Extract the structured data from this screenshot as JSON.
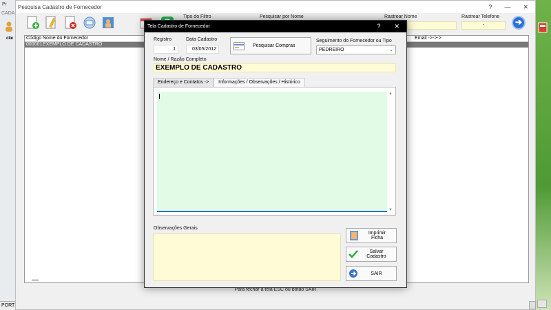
{
  "bg": {
    "app_title_abbrev": "Pr",
    "app_menu_abbrev": "CADA",
    "left_button_abbrev": "clie",
    "status_abbrev": "PORT"
  },
  "main_window": {
    "title": "Pesquisa Cadastro de Fornecedor",
    "help": "?",
    "minimize": "—",
    "close": "✕",
    "toolbar": {
      "filter_type_label": "Tipo do Filtro",
      "search_name_label": "Pesquisar por Nome",
      "track_name_label": "Rastrear Nome",
      "track_phone_label": "Rastrear Telefone",
      "track_phone_value": "-",
      "go_glyph": "➔"
    },
    "grid": {
      "columns": [
        "Código",
        "Nome do Fornecedor",
        "Email ->->->"
      ],
      "rows": [
        {
          "code": "000001",
          "name": "EXEMPLO DE CADASTRO"
        }
      ]
    },
    "hint": "Para fechar a tela ESC ou botão SAIR"
  },
  "dialog": {
    "title": "Tela Cadastro de Fornecedor",
    "help": "?",
    "close": "✕",
    "registro_label": "Registro",
    "registro_value": "1",
    "data_label": "Data Cadastro",
    "data_value": "03/05/2012",
    "compras_button": "Pesquisar Compras",
    "segmento_label": "Seguimento do Fornecedor ou Tipo",
    "segmento_value": "PEDREIRO",
    "nome_label": "Nome / Razão Completo",
    "nome_value": "EXEMPLO DE CADASTRO",
    "tabs": [
      {
        "label": "Endereço e Contatos ->"
      },
      {
        "label": "Informações / Observações / Histórico"
      }
    ],
    "obs_label": "Observações Gerais",
    "btn_imprimir": "Imprimir Ficha",
    "btn_salvar": "Salvar Cadastro",
    "btn_sair": "SAIR"
  },
  "colors": {
    "memo_bg": "#e2fbe6",
    "yellow_field": "#fffbd6",
    "dialog_title_bg": "#000000",
    "grid_selected": "#777777"
  }
}
